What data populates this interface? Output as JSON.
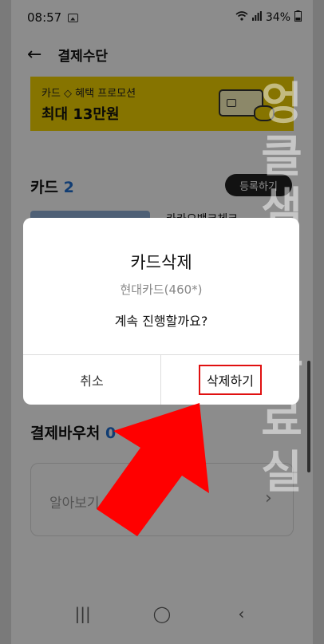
{
  "status": {
    "time": "08:57",
    "battery": "34%"
  },
  "header": {
    "back": "←",
    "title": "결제수단"
  },
  "promo": {
    "line1": "카드 ◇ 혜택 프로모션",
    "line2": "최대 13만원"
  },
  "cards": {
    "label": "카드",
    "count": "2",
    "register": "등록하기",
    "first_card_name": "카카오뱅크체크"
  },
  "voucher": {
    "label": "결제바우처",
    "count": "0",
    "link_text": "알아보기",
    "chevron": "›"
  },
  "dialog": {
    "title": "카드삭제",
    "subtitle": "현대카드(460*)",
    "message": "계속 진행할까요?",
    "cancel": "취소",
    "delete": "삭제하기"
  },
  "watermark": "엉클샘이웹자료실",
  "nav": {
    "recent": "|||",
    "home": "◯",
    "back": "‹"
  },
  "colors": {
    "promo": "#f5d400",
    "accent_blue": "#1f6fd1",
    "highlight_red": "#e01010",
    "arrow_red": "#ff0000"
  }
}
